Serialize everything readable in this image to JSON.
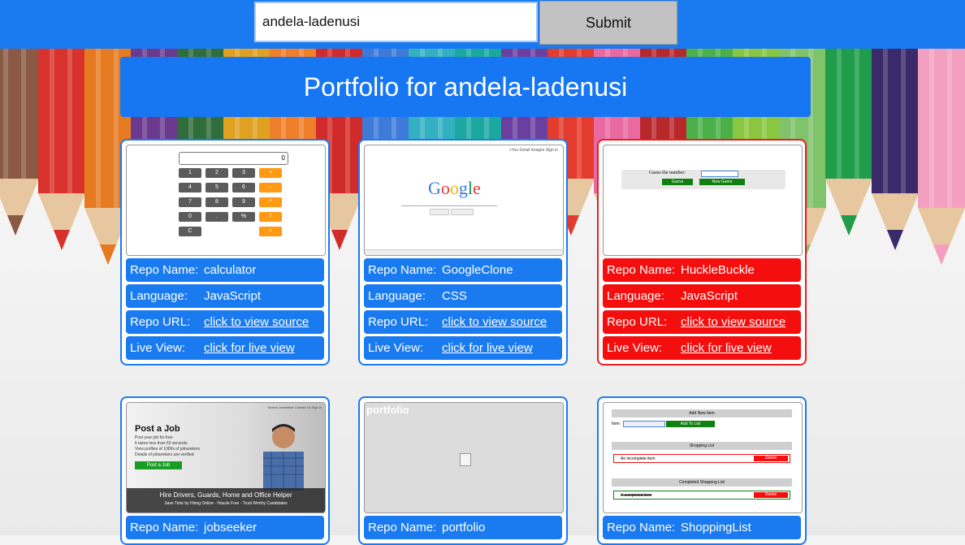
{
  "search": {
    "value": "andela-ladenusi",
    "submit_label": "Submit"
  },
  "page_title": "Portfolio for andela-ladenusi",
  "colors": {
    "accent": "#1a7af0",
    "alert": "#f50e0e",
    "card_bg": "#ffffff"
  },
  "row_labels": {
    "name": "Repo Name:",
    "language": "Language:",
    "url": "Repo URL:",
    "live": "Live View:"
  },
  "cards": [
    {
      "name": "calculator",
      "language": "JavaScript",
      "url_text": "click to view source",
      "live_text": "click for live view",
      "highlight": false,
      "thumb": {
        "display": "0",
        "keys": [
          "1",
          "2",
          "3",
          "+",
          "4",
          "5",
          "6",
          "-",
          "7",
          "8",
          "9",
          "*",
          "0",
          ".",
          "%",
          "/",
          "C",
          "="
        ]
      }
    },
    {
      "name": "GoogleClone",
      "language": "CSS",
      "url_text": "click to view source",
      "live_text": "click for live view",
      "highlight": false,
      "thumb": {
        "logo": "Google",
        "nav": "+You   Gmail   Images   Sign in"
      }
    },
    {
      "name": "HuckleBuckle",
      "language": "JavaScript",
      "url_text": "click to view source",
      "live_text": "click for live view",
      "highlight": true,
      "thumb": {
        "prompt": "Guess the number:",
        "guess_btn": "Guess",
        "new_game_btn": "New Game"
      }
    },
    {
      "name": "jobseeker",
      "language": "",
      "url_text": "",
      "live_text": "",
      "highlight": false,
      "thumb": {
        "title": "Post a Job",
        "lines": [
          "Post your job for free.",
          "It takes less than 60 seconds.",
          "View profiles of 1000s of jobseekers",
          "Details of jobseekers are verified"
        ],
        "button": "Post a Job",
        "banner": "Hire Drivers, Guards, Home and Office Helper",
        "sub": "Save Time by Hiring Online  ·  Hassle Free  ·  Trust Worthy Candidates",
        "nav": "Search Jobseeker   Contact Us   Sign in"
      }
    },
    {
      "name": "portfolio",
      "language": "",
      "url_text": "",
      "live_text": "",
      "highlight": false,
      "thumb": {
        "label": "portfolio"
      }
    },
    {
      "name": "ShoppingList",
      "language": "",
      "url_text": "",
      "live_text": "",
      "highlight": false,
      "thumb": {
        "add_header": "Add New Item",
        "item_label": "Item:",
        "add_btn": "Add To List",
        "list_header": "Shopping List",
        "incomplete": "An incomplete item",
        "completed_header": "Completed Shopping List",
        "completed": "A completed item",
        "delete": "Delete"
      }
    }
  ]
}
